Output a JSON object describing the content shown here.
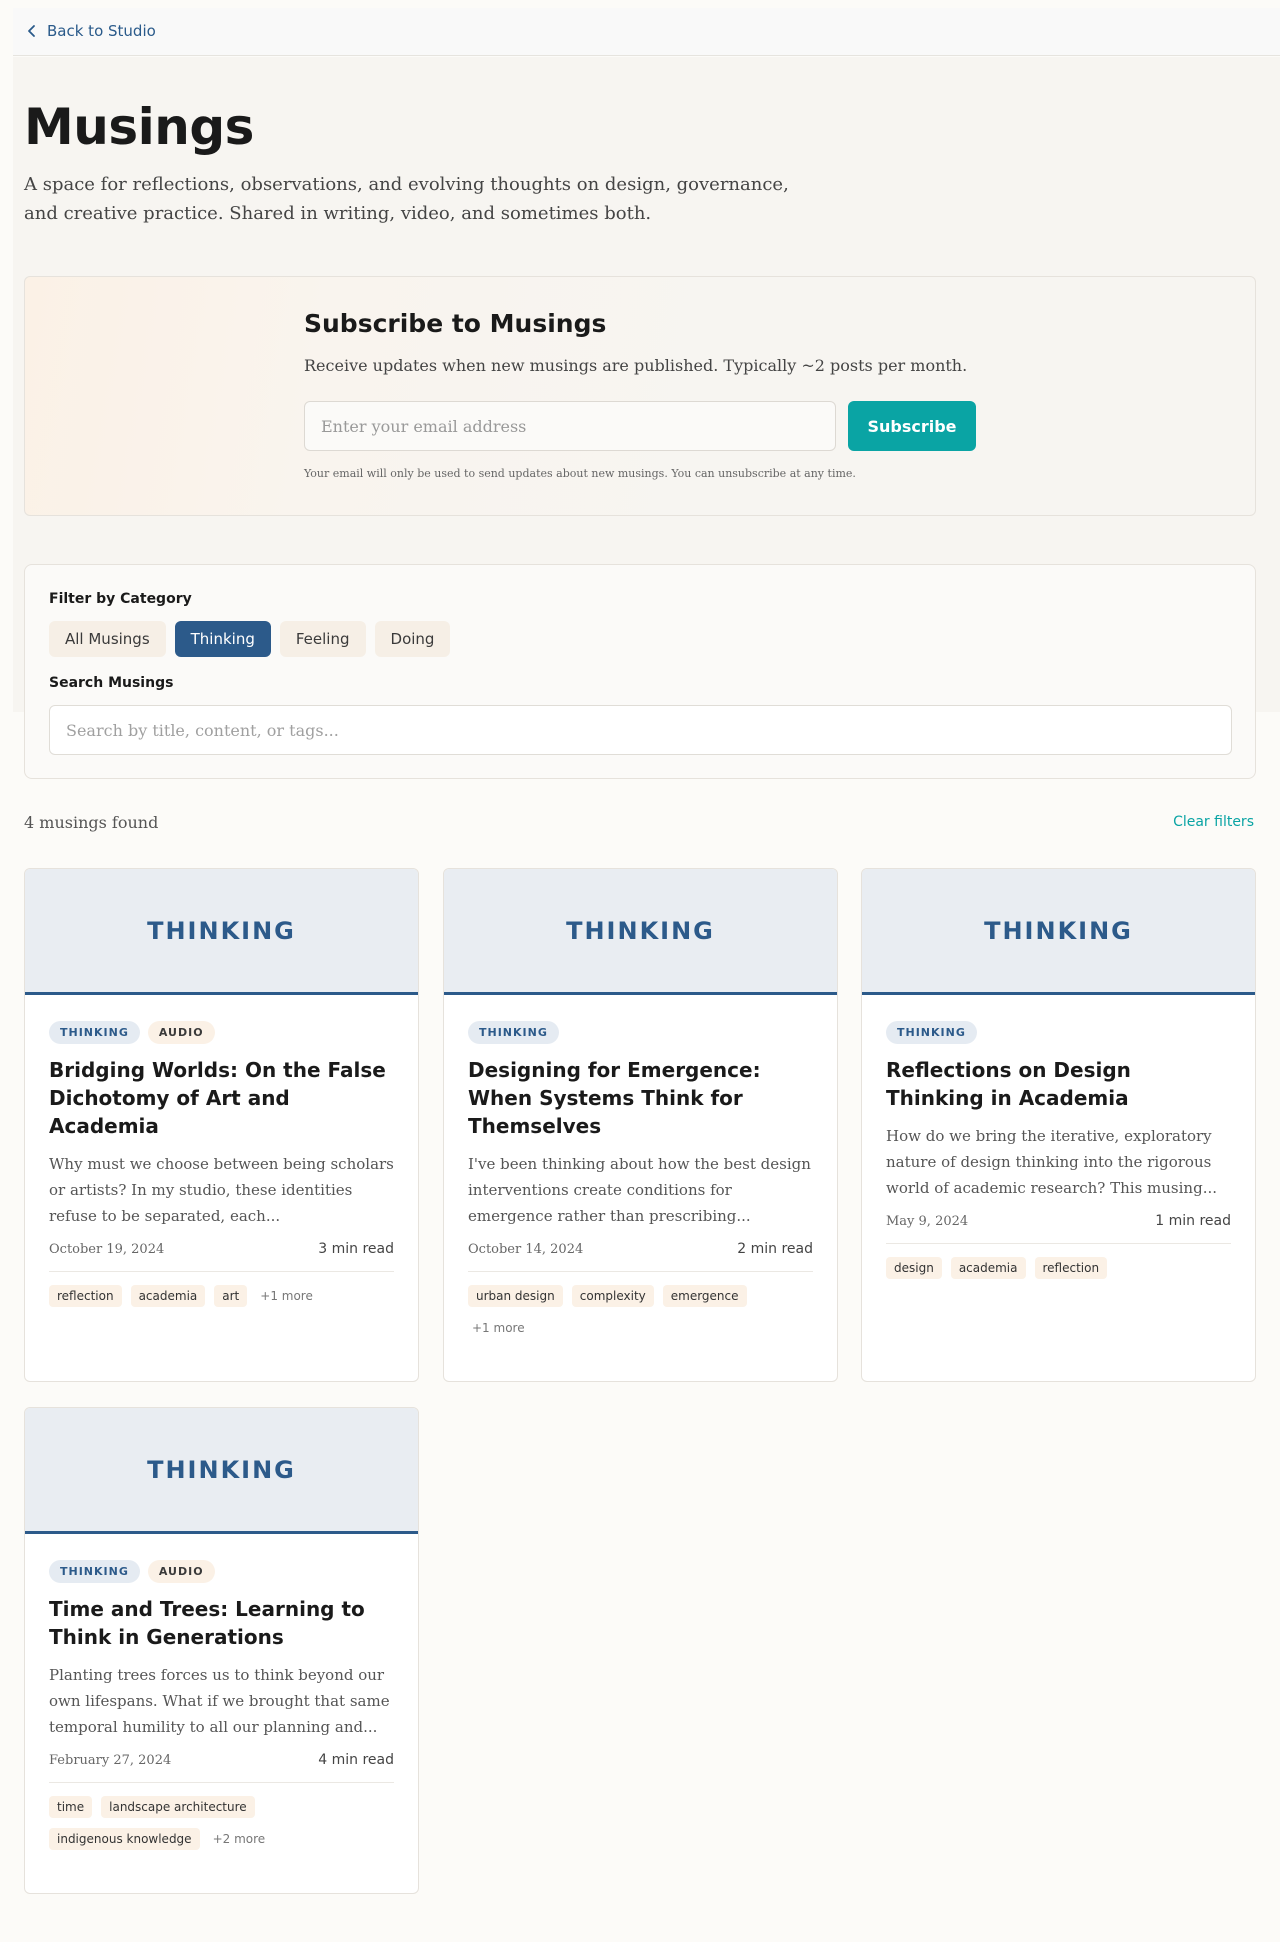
{
  "nav": {
    "back_label": "Back to Studio"
  },
  "header": {
    "title": "Musings",
    "description": "A space for reflections, observations, and evolving thoughts on design, governance, and creative practice. Shared in writing, video, and sometimes both."
  },
  "subscribe": {
    "title": "Subscribe to Musings",
    "description": "Receive updates when new musings are published. Typically ~2 posts per month.",
    "email_placeholder": "Enter your email address",
    "button_label": "Subscribe",
    "note": "Your email will only be used to send updates about new musings. You can unsubscribe at any time."
  },
  "filters": {
    "category_label": "Filter by Category",
    "categories": [
      "All Musings",
      "Thinking",
      "Feeling",
      "Doing"
    ],
    "active_category": "Thinking",
    "search_label": "Search Musings",
    "search_placeholder": "Search by title, content, or tags..."
  },
  "results": {
    "count_text": "4 musings found",
    "clear_label": "Clear filters"
  },
  "colors": {
    "accent": "#2c5a8a",
    "teal": "#0aa4a4",
    "tag_bg": "#fbf1e6",
    "banner_bg": "#e9edf2"
  },
  "cards": [
    {
      "banner": "THINKING",
      "category_badge": "THINKING",
      "type_badge": "AUDIO",
      "title": "Bridging Worlds: On the False Dichotomy of Art and Academia",
      "excerpt": "Why must we choose between being scholars or artists? In my studio, these identities refuse to be separated, each...",
      "date": "October 19, 2024",
      "read_time": "3 min read",
      "tags": [
        "reflection",
        "academia",
        "art"
      ],
      "more": "+1 more"
    },
    {
      "banner": "THINKING",
      "category_badge": "THINKING",
      "type_badge": "",
      "title": "Designing for Emergence: When Systems Think for Themselves",
      "excerpt": "I've been thinking about how the best design interventions create conditions for emergence rather than prescribing...",
      "date": "October 14, 2024",
      "read_time": "2 min read",
      "tags": [
        "urban design",
        "complexity",
        "emergence"
      ],
      "more": "+1 more"
    },
    {
      "banner": "THINKING",
      "category_badge": "THINKING",
      "type_badge": "",
      "title": "Reflections on Design Thinking in Academia",
      "excerpt": "How do we bring the iterative, exploratory nature of design thinking into the rigorous world of academic research? This musing...",
      "date": "May 9, 2024",
      "read_time": "1 min read",
      "tags": [
        "design",
        "academia",
        "reflection"
      ],
      "more": ""
    },
    {
      "banner": "THINKING",
      "category_badge": "THINKING",
      "type_badge": "AUDIO",
      "title": "Time and Trees: Learning to Think in Generations",
      "excerpt": "Planting trees forces us to think beyond our own lifespans. What if we brought that same temporal humility to all our planning and...",
      "date": "February 27, 2024",
      "read_time": "4 min read",
      "tags": [
        "time",
        "landscape architecture",
        "indigenous knowledge"
      ],
      "more": "+2 more"
    }
  ]
}
